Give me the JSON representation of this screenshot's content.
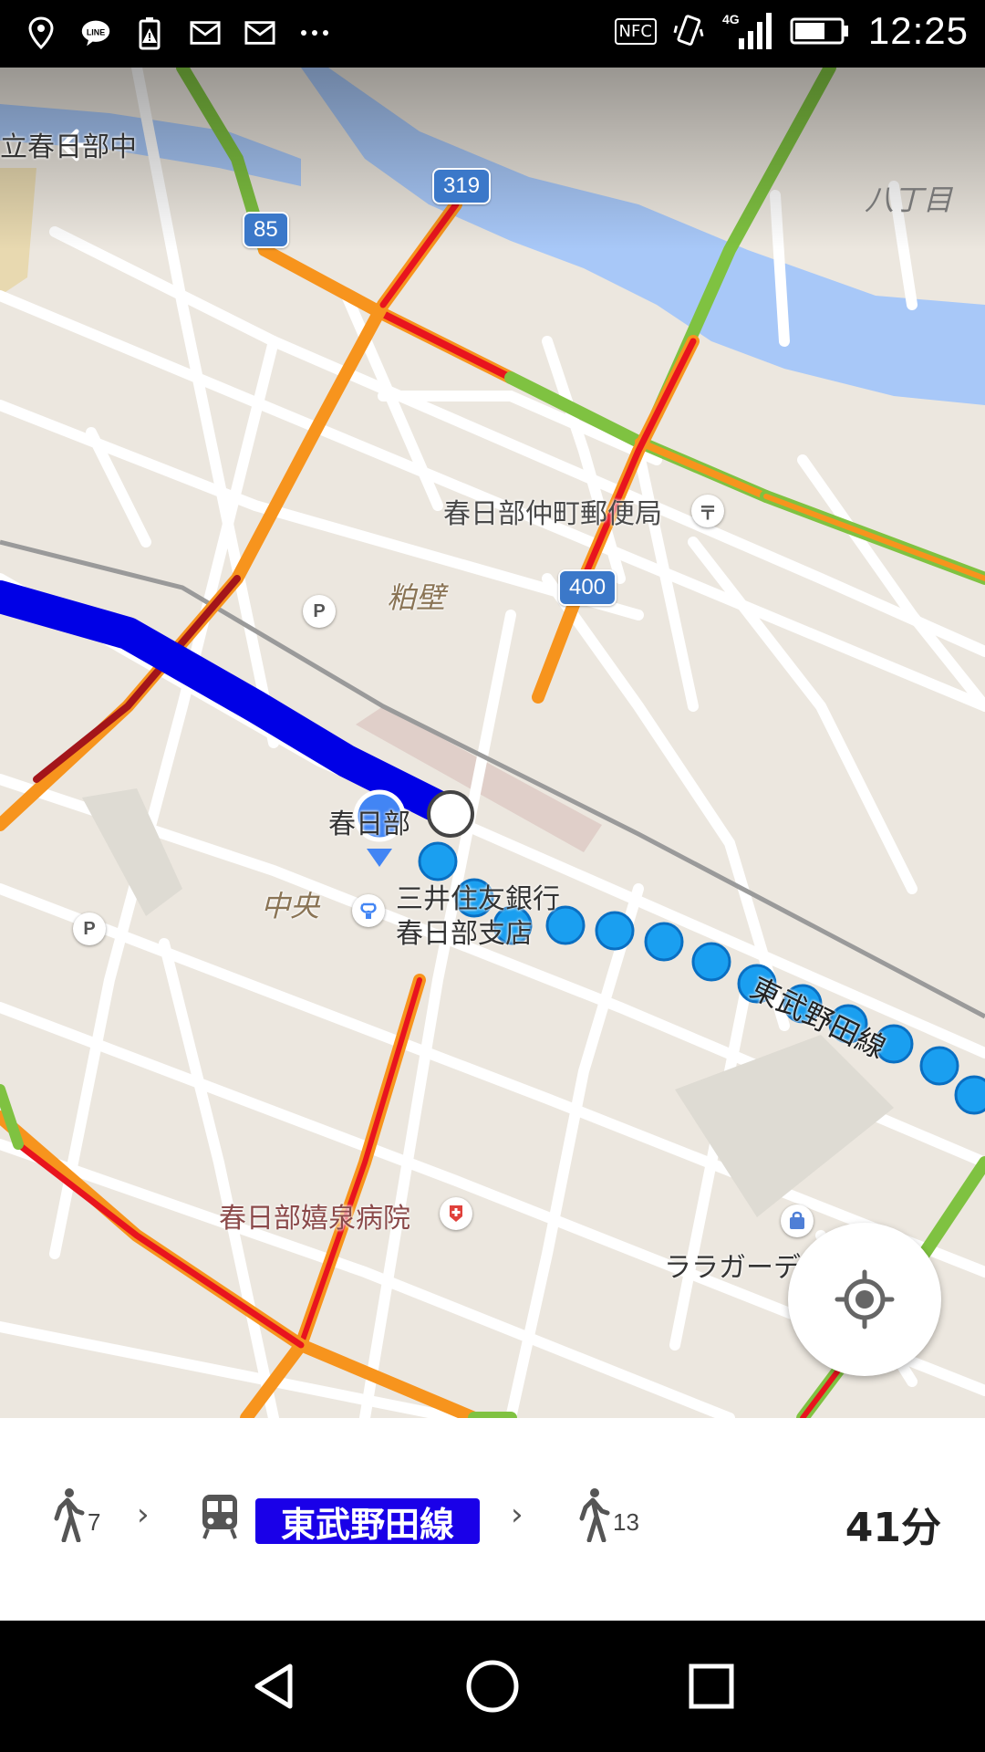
{
  "status_bar": {
    "left_icons": [
      "location-icon",
      "line-app-icon",
      "battery-alert-icon",
      "mail-icon",
      "mail-icon",
      "more-icon"
    ],
    "nfc_label": "NFC",
    "network": "4G",
    "time": "12:25"
  },
  "map": {
    "labels": {
      "top_left": "立春日部中",
      "top_right": "八丁目",
      "post_office": "春日部仲町郵便局",
      "kasukabe_area": "粕壁",
      "station": "春日部",
      "chuo": "中央",
      "bank_line1": "三井住友銀行",
      "bank_line2": "春日部支店",
      "train_line": "東武野田線",
      "hospital": "春日部嬉泉病院",
      "mall": "ララガーデン"
    },
    "shields": {
      "r85": "85",
      "r319": "319",
      "r400": "400"
    },
    "pins": {
      "parking": "P",
      "post": "〒"
    }
  },
  "route": {
    "walk_start_min": "7",
    "line_name": "東武野田線",
    "walk_end_min": "13",
    "total_duration": "41分",
    "line_color": "#1a00e8"
  },
  "colors": {
    "route_blue": "#0000e6",
    "dot_blue": "#1a9ff0",
    "traffic_red": "#e8141e",
    "traffic_orange": "#f7941d",
    "traffic_green": "#7fc241"
  }
}
